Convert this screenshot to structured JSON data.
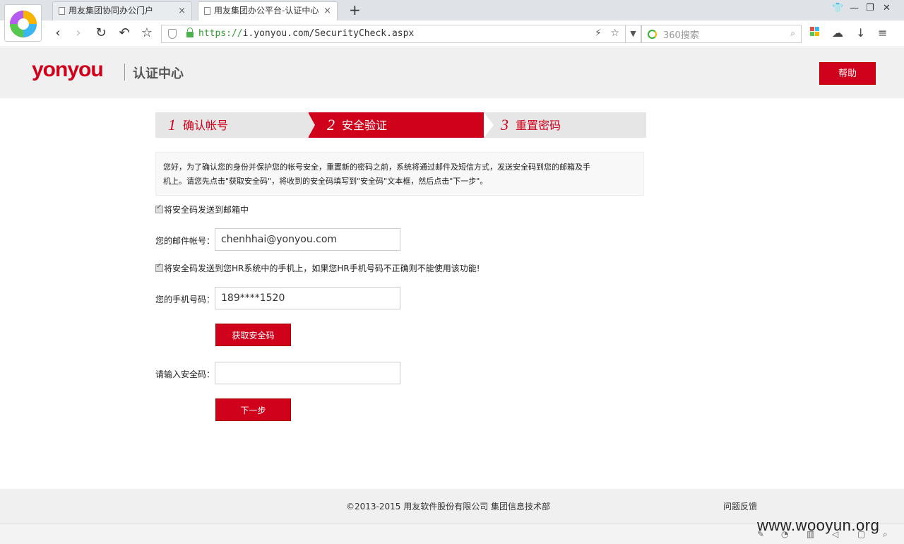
{
  "browser": {
    "tabs": [
      {
        "title": "用友集团协同办公门户",
        "close": "×"
      },
      {
        "title": "用友集团办公平台-认证中心",
        "close": "×"
      }
    ],
    "new_tab": "+",
    "url_scheme": "https://",
    "url_rest": "i.yonyou.com/SecurityCheck.aspx",
    "search_placeholder": "360搜索",
    "win_controls": {
      "skin": "👕",
      "minimize": "—",
      "restore": "❐",
      "close": "✕"
    }
  },
  "header": {
    "logo": "yonyou",
    "title": "认证中心",
    "help": "帮助"
  },
  "steps": [
    {
      "num": "1",
      "label": "确认帐号"
    },
    {
      "num": "2",
      "label": "安全验证"
    },
    {
      "num": "3",
      "label": "重置密码"
    }
  ],
  "notice": {
    "line1": "您好，为了确认您的身份并保护您的帐号安全，重置新的密码之前，系统将通过邮件及短信方式，发送安全码到您的邮箱及手",
    "line2": "机上。请您先点击\"获取安全码\"，将收到的安全码填写到\"安全码\"文本框，然后点击\"下一步\"。"
  },
  "form": {
    "email_checkbox": "将安全码发送到邮箱中",
    "email_label": "您的邮件帐号：",
    "email_value": "chenhhai@yonyou.com",
    "phone_checkbox": "将安全码发送到您HR系统中的手机上，如果您HR手机号码不正确则不能使用该功能!",
    "phone_label": "您的手机号码：",
    "phone_value": "189****1520",
    "get_code": "获取安全码",
    "code_label": "请输入安全码：",
    "code_value": "",
    "next": "下一步"
  },
  "footer": {
    "copyright": "©2013-2015 用友软件股份有限公司 集团信息技术部",
    "feedback": "问题反馈"
  },
  "watermark": "www.wooyun.org",
  "colors": {
    "brand": "#d0021b",
    "header_bg": "#f0f0f0"
  }
}
